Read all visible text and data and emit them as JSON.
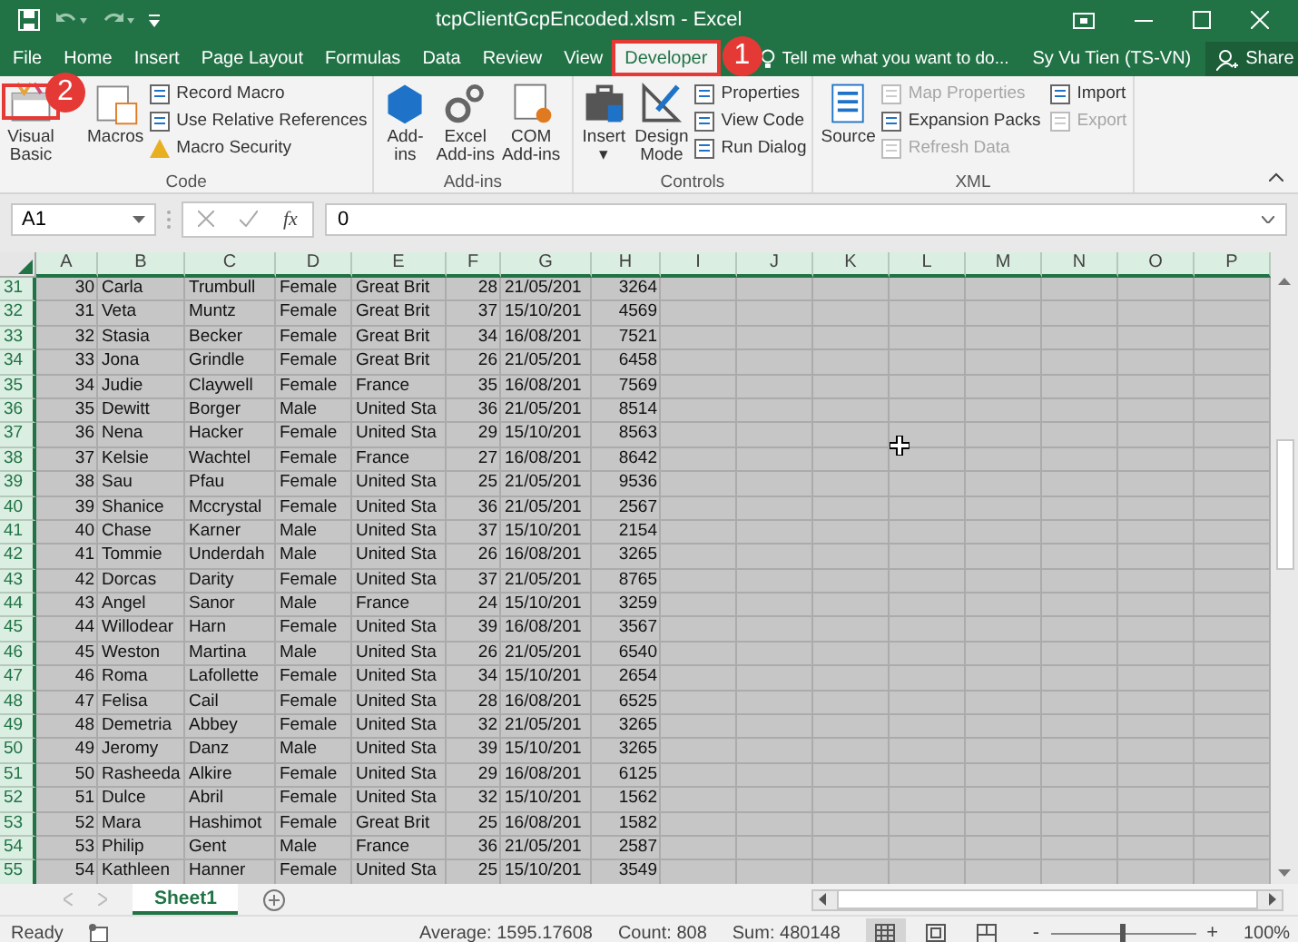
{
  "title_bar": {
    "title": "tcpClientGcpEncoded.xlsm - Excel"
  },
  "ribbon_tabs": [
    {
      "label": "File",
      "selected": false
    },
    {
      "label": "Home",
      "selected": false
    },
    {
      "label": "Insert",
      "selected": false
    },
    {
      "label": "Page Layout",
      "selected": false
    },
    {
      "label": "Formulas",
      "selected": false
    },
    {
      "label": "Data",
      "selected": false
    },
    {
      "label": "Review",
      "selected": false
    },
    {
      "label": "View",
      "selected": false
    },
    {
      "label": "Developer",
      "selected": true
    }
  ],
  "tell_me": {
    "placeholder": "Tell me what you want to do..."
  },
  "user": "Sy Vu Tien (TS-VN)",
  "share": "Share",
  "ribbon_groups": [
    {
      "name": "Code",
      "items": [
        {
          "kind": "large",
          "lines": [
            "Visual",
            "Basic"
          ]
        },
        {
          "kind": "large",
          "lines": [
            "Macros"
          ]
        },
        {
          "kind": "small",
          "label": "Record Macro",
          "disabled": false
        },
        {
          "kind": "small",
          "label": "Use Relative References",
          "disabled": false
        },
        {
          "kind": "small",
          "label": "Macro Security",
          "disabled": false
        }
      ]
    },
    {
      "name": "Add-ins",
      "items": [
        {
          "kind": "large",
          "lines": [
            "Add-",
            "ins"
          ]
        },
        {
          "kind": "large",
          "lines": [
            "Excel",
            "Add-ins"
          ]
        },
        {
          "kind": "large",
          "lines": [
            "COM",
            "Add-ins"
          ]
        }
      ]
    },
    {
      "name": "Controls",
      "items": [
        {
          "kind": "large",
          "lines": [
            "Insert",
            "▾"
          ]
        },
        {
          "kind": "large",
          "lines": [
            "Design",
            "Mode"
          ]
        },
        {
          "kind": "small",
          "label": "Properties",
          "disabled": false
        },
        {
          "kind": "small",
          "label": "View Code",
          "disabled": false
        },
        {
          "kind": "small",
          "label": "Run Dialog",
          "disabled": false
        }
      ]
    },
    {
      "name": "XML",
      "items": [
        {
          "kind": "large",
          "lines": [
            "Source"
          ]
        },
        {
          "kind": "small",
          "label": "Map Properties",
          "disabled": true
        },
        {
          "kind": "small",
          "label": "Expansion Packs",
          "disabled": false
        },
        {
          "kind": "small",
          "label": "Refresh Data",
          "disabled": true
        },
        {
          "kind": "small",
          "label": "Import",
          "disabled": false
        },
        {
          "kind": "small",
          "label": "Export",
          "disabled": true
        }
      ]
    }
  ],
  "callouts": [
    {
      "number": "1"
    },
    {
      "number": "2"
    }
  ],
  "formula_bar": {
    "name_box": "A1",
    "fx": "fx",
    "value": "0"
  },
  "sheet": {
    "all_cells_selected": true,
    "columns": [
      "A",
      "B",
      "C",
      "D",
      "E",
      "F",
      "G",
      "H",
      "I",
      "J",
      "K",
      "L",
      "M",
      "N",
      "O",
      "P"
    ],
    "rows": [
      {
        "number": "31",
        "cells": [
          "30",
          "Carla",
          "Trumbull",
          "Female",
          "Great Brit",
          "28",
          "21/05/201",
          "3264"
        ]
      },
      {
        "number": "32",
        "cells": [
          "31",
          "Veta",
          "Muntz",
          "Female",
          "Great Brit",
          "37",
          "15/10/201",
          "4569"
        ]
      },
      {
        "number": "33",
        "cells": [
          "32",
          "Stasia",
          "Becker",
          "Female",
          "Great Brit",
          "34",
          "16/08/201",
          "7521"
        ]
      },
      {
        "number": "34",
        "cells": [
          "33",
          "Jona",
          "Grindle",
          "Female",
          "Great Brit",
          "26",
          "21/05/201",
          "6458"
        ]
      },
      {
        "number": "35",
        "cells": [
          "34",
          "Judie",
          "Claywell",
          "Female",
          "France",
          "35",
          "16/08/201",
          "7569"
        ]
      },
      {
        "number": "36",
        "cells": [
          "35",
          "Dewitt",
          "Borger",
          "Male",
          "United Sta",
          "36",
          "21/05/201",
          "8514"
        ]
      },
      {
        "number": "37",
        "cells": [
          "36",
          "Nena",
          "Hacker",
          "Female",
          "United Sta",
          "29",
          "15/10/201",
          "8563"
        ]
      },
      {
        "number": "38",
        "cells": [
          "37",
          "Kelsie",
          "Wachtel",
          "Female",
          "France",
          "27",
          "16/08/201",
          "8642"
        ]
      },
      {
        "number": "39",
        "cells": [
          "38",
          "Sau",
          "Pfau",
          "Female",
          "United Sta",
          "25",
          "21/05/201",
          "9536"
        ]
      },
      {
        "number": "40",
        "cells": [
          "39",
          "Shanice",
          "Mccrystal",
          "Female",
          "United Sta",
          "36",
          "21/05/201",
          "2567"
        ]
      },
      {
        "number": "41",
        "cells": [
          "40",
          "Chase",
          "Karner",
          "Male",
          "United Sta",
          "37",
          "15/10/201",
          "2154"
        ]
      },
      {
        "number": "42",
        "cells": [
          "41",
          "Tommie",
          "Underdah",
          "Male",
          "United Sta",
          "26",
          "16/08/201",
          "3265"
        ]
      },
      {
        "number": "43",
        "cells": [
          "42",
          "Dorcas",
          "Darity",
          "Female",
          "United Sta",
          "37",
          "21/05/201",
          "8765"
        ]
      },
      {
        "number": "44",
        "cells": [
          "43",
          "Angel",
          "Sanor",
          "Male",
          "France",
          "24",
          "15/10/201",
          "3259"
        ]
      },
      {
        "number": "45",
        "cells": [
          "44",
          "Willodear",
          "Harn",
          "Female",
          "United Sta",
          "39",
          "16/08/201",
          "3567"
        ]
      },
      {
        "number": "46",
        "cells": [
          "45",
          "Weston",
          "Martina",
          "Male",
          "United Sta",
          "26",
          "21/05/201",
          "6540"
        ]
      },
      {
        "number": "47",
        "cells": [
          "46",
          "Roma",
          "Lafollette",
          "Female",
          "United Sta",
          "34",
          "15/10/201",
          "2654"
        ]
      },
      {
        "number": "48",
        "cells": [
          "47",
          "Felisa",
          "Cail",
          "Female",
          "United Sta",
          "28",
          "16/08/201",
          "6525"
        ]
      },
      {
        "number": "49",
        "cells": [
          "48",
          "Demetria",
          "Abbey",
          "Female",
          "United Sta",
          "32",
          "21/05/201",
          "3265"
        ]
      },
      {
        "number": "50",
        "cells": [
          "49",
          "Jeromy",
          "Danz",
          "Male",
          "United Sta",
          "39",
          "15/10/201",
          "3265"
        ]
      },
      {
        "number": "51",
        "cells": [
          "50",
          "Rasheeda",
          "Alkire",
          "Female",
          "United Sta",
          "29",
          "16/08/201",
          "6125"
        ]
      },
      {
        "number": "52",
        "cells": [
          "51",
          "Dulce",
          "Abril",
          "Female",
          "United Sta",
          "32",
          "15/10/201",
          "1562"
        ]
      },
      {
        "number": "53",
        "cells": [
          "52",
          "Mara",
          "Hashimot",
          "Female",
          "Great Brit",
          "25",
          "16/08/201",
          "1582"
        ]
      },
      {
        "number": "54",
        "cells": [
          "53",
          "Philip",
          "Gent",
          "Male",
          "France",
          "36",
          "21/05/201",
          "2587"
        ]
      },
      {
        "number": "55",
        "cells": [
          "54",
          "Kathleen",
          "Hanner",
          "Female",
          "United Sta",
          "25",
          "15/10/201",
          "3549"
        ]
      }
    ]
  },
  "sheet_tabs": [
    {
      "label": "Sheet1",
      "selected": true
    }
  ],
  "status_bar": {
    "status": "Ready",
    "average": "Average: 1595.17608",
    "count": "Count: 808",
    "sum": "Sum: 480148",
    "views": [
      {
        "selected": true
      },
      {
        "selected": false
      },
      {
        "selected": false
      }
    ],
    "zoom_out": "-",
    "zoom_in": "+",
    "zoom": {
      "level": 0.5
    },
    "zoom_text": "100%"
  }
}
